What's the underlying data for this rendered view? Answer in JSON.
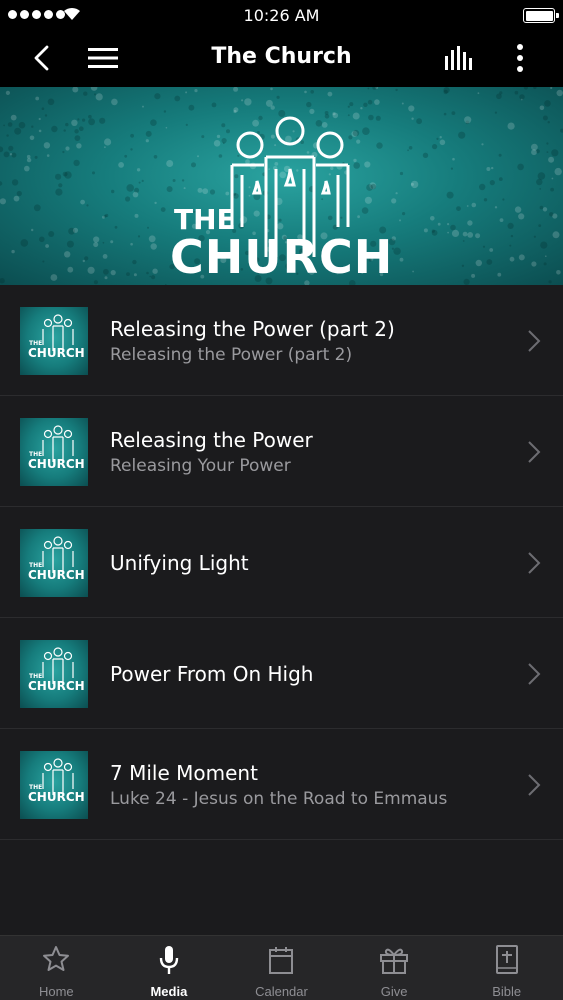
{
  "status_bar": {
    "time": "10:26 AM"
  },
  "nav": {
    "title": "The Church"
  },
  "banner": {
    "logo_line1": "THE",
    "logo_line2": "CHURCH"
  },
  "items": [
    {
      "title": "Releasing the Power (part 2)",
      "subtitle": "Releasing the Power (part 2)"
    },
    {
      "title": "Releasing the Power",
      "subtitle": "Releasing Your Power"
    },
    {
      "title": "Unifying Light",
      "subtitle": ""
    },
    {
      "title": "Power From On High",
      "subtitle": ""
    },
    {
      "title": "7 Mile Moment",
      "subtitle": "Luke 24 - Jesus on the Road to Emmaus"
    }
  ],
  "tabs": [
    {
      "label": "Home",
      "icon": "star-icon",
      "active": false
    },
    {
      "label": "Media",
      "icon": "microphone-icon",
      "active": true
    },
    {
      "label": "Calendar",
      "icon": "calendar-icon",
      "active": false
    },
    {
      "label": "Give",
      "icon": "gift-icon",
      "active": false
    },
    {
      "label": "Bible",
      "icon": "bible-icon",
      "active": false
    }
  ],
  "colors": {
    "accent_teal": "#1e8f8c",
    "list_background": "#1b1b1d",
    "tab_bar": "#262628"
  }
}
